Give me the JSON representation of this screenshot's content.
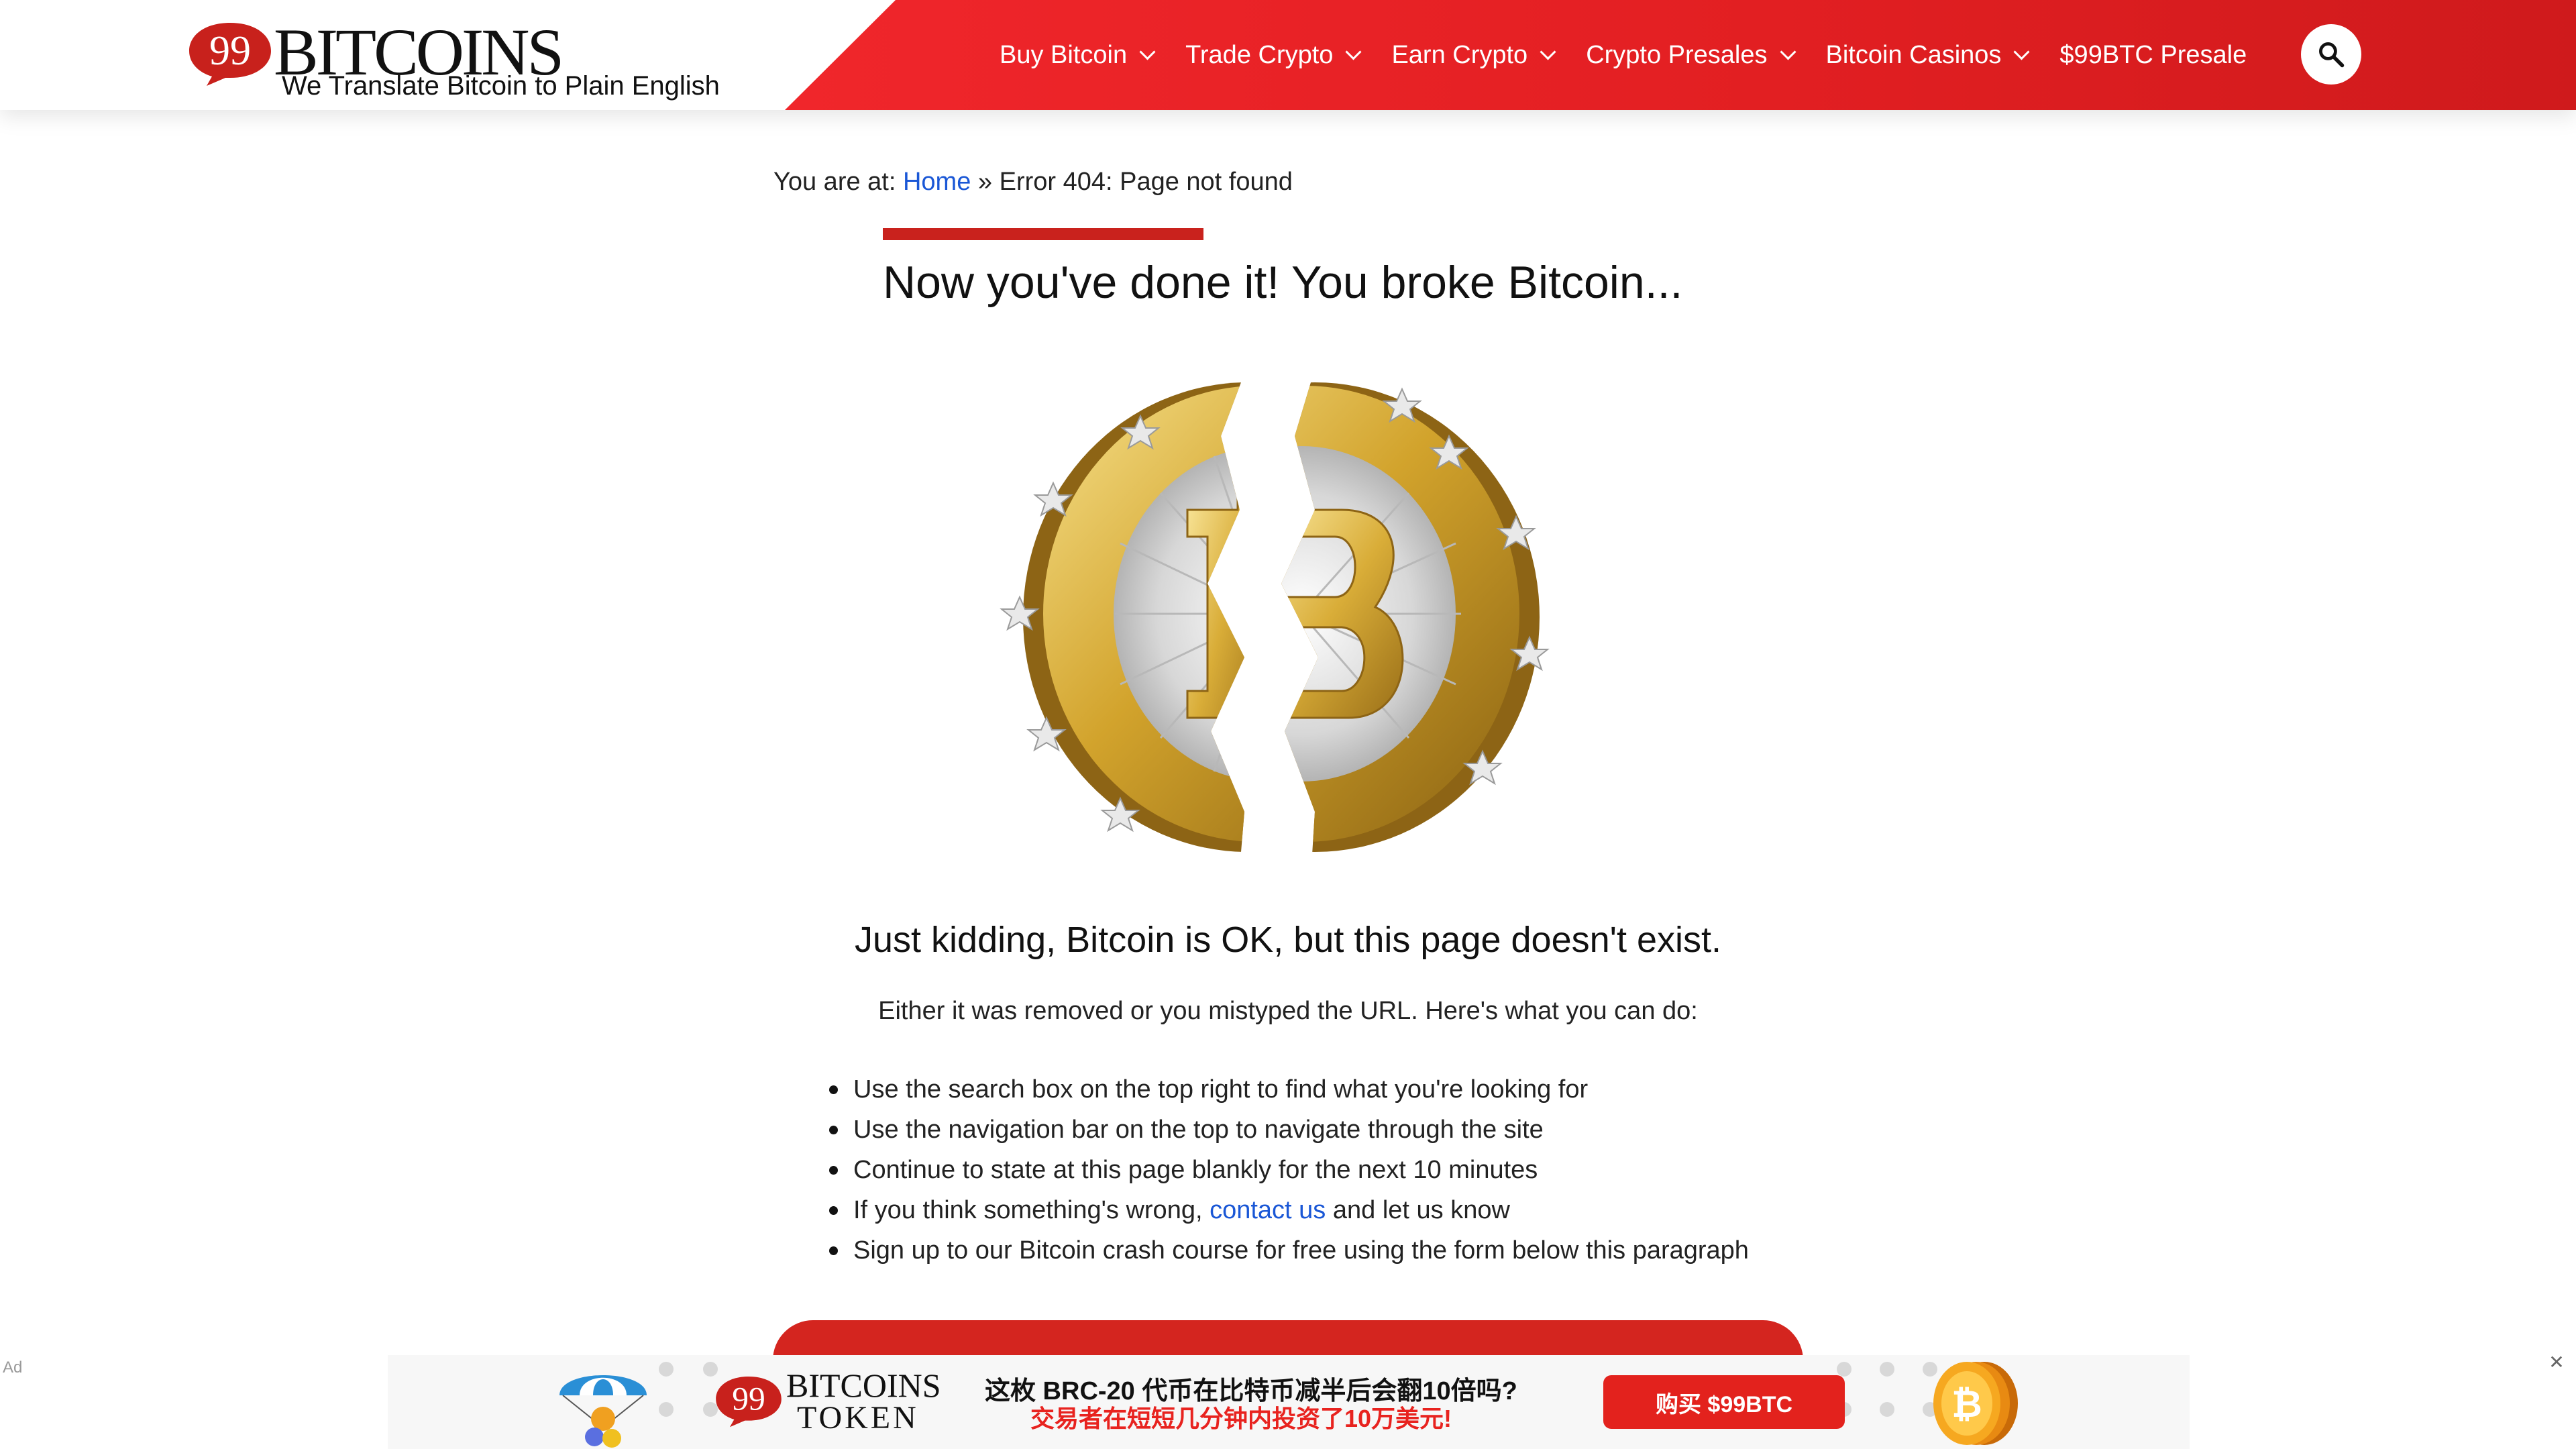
{
  "header": {
    "logo_text": "BITCOINS",
    "logo_number": "99",
    "tagline": "We Translate Bitcoin to Plain English",
    "nav": [
      {
        "label": "Buy Bitcoin",
        "dropdown": true
      },
      {
        "label": "Trade Crypto",
        "dropdown": true
      },
      {
        "label": "Earn Crypto",
        "dropdown": true
      },
      {
        "label": "Crypto Presales",
        "dropdown": true
      },
      {
        "label": "Bitcoin Casinos",
        "dropdown": true
      },
      {
        "label": "$99BTC Presale",
        "dropdown": false
      }
    ],
    "search_icon": "search-icon",
    "brand_color": "#e62324"
  },
  "breadcrumb": {
    "prefix": "You are at: ",
    "home": "Home",
    "separator": " » ",
    "current": "Error 404: Page not found"
  },
  "main": {
    "title": "Now you've done it! You broke Bitcoin...",
    "subhead": "Just kidding, Bitcoin is OK, but this page doesn't exist.",
    "lead": "Either it was removed or you mistyped the URL. Here's what you can do:",
    "tips": [
      "Use the search box on the top right to find what you're looking for",
      "Use the navigation bar on the top to navigate through the site",
      "Continue to state at this page blankly for the next 10 minutes",
      {
        "before": "If you think something's wrong, ",
        "link": "contact us",
        "after": " and let us know"
      },
      "Sign up to our Bitcoin crash course for free using the form below this paragraph"
    ],
    "image": "broken-bitcoin-coin"
  },
  "ad": {
    "label": "Ad",
    "close": "✕",
    "logo_number": "99",
    "logo_text": "BITCOINS",
    "logo_sub": "TOKEN",
    "line1": "这枚 BRC-20 代币在比特币减半后会翻10倍吗?",
    "line2": "交易者在短短几分钟内投资了10万美元!",
    "button": "购买 $99BTC"
  }
}
